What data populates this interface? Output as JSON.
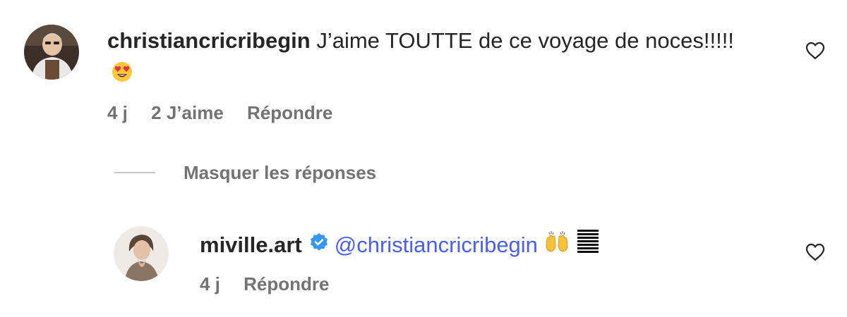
{
  "comment": {
    "username": "christiancricribegin",
    "text": "J’aime TOUTTE de ce voyage de noces!!!!!",
    "emoji_icon": "heart-eyes-emoji",
    "time": "4 j",
    "likes": "2 J’aime",
    "reply_label": "Répondre"
  },
  "replies_toggle": {
    "label": "Masquer les réponses"
  },
  "reply": {
    "username": "miville.art",
    "verified": true,
    "mention": "@christiancricribegin",
    "emoji_icon": "raised-hands-emoji",
    "extra_icon": "striped-bars-icon",
    "time": "4 j",
    "reply_label": "Répondre"
  },
  "colors": {
    "text": "#262626",
    "meta": "#737373",
    "mention": "#4a5ff0",
    "verified": "#3897f0",
    "divider": "#c7c7c7"
  }
}
